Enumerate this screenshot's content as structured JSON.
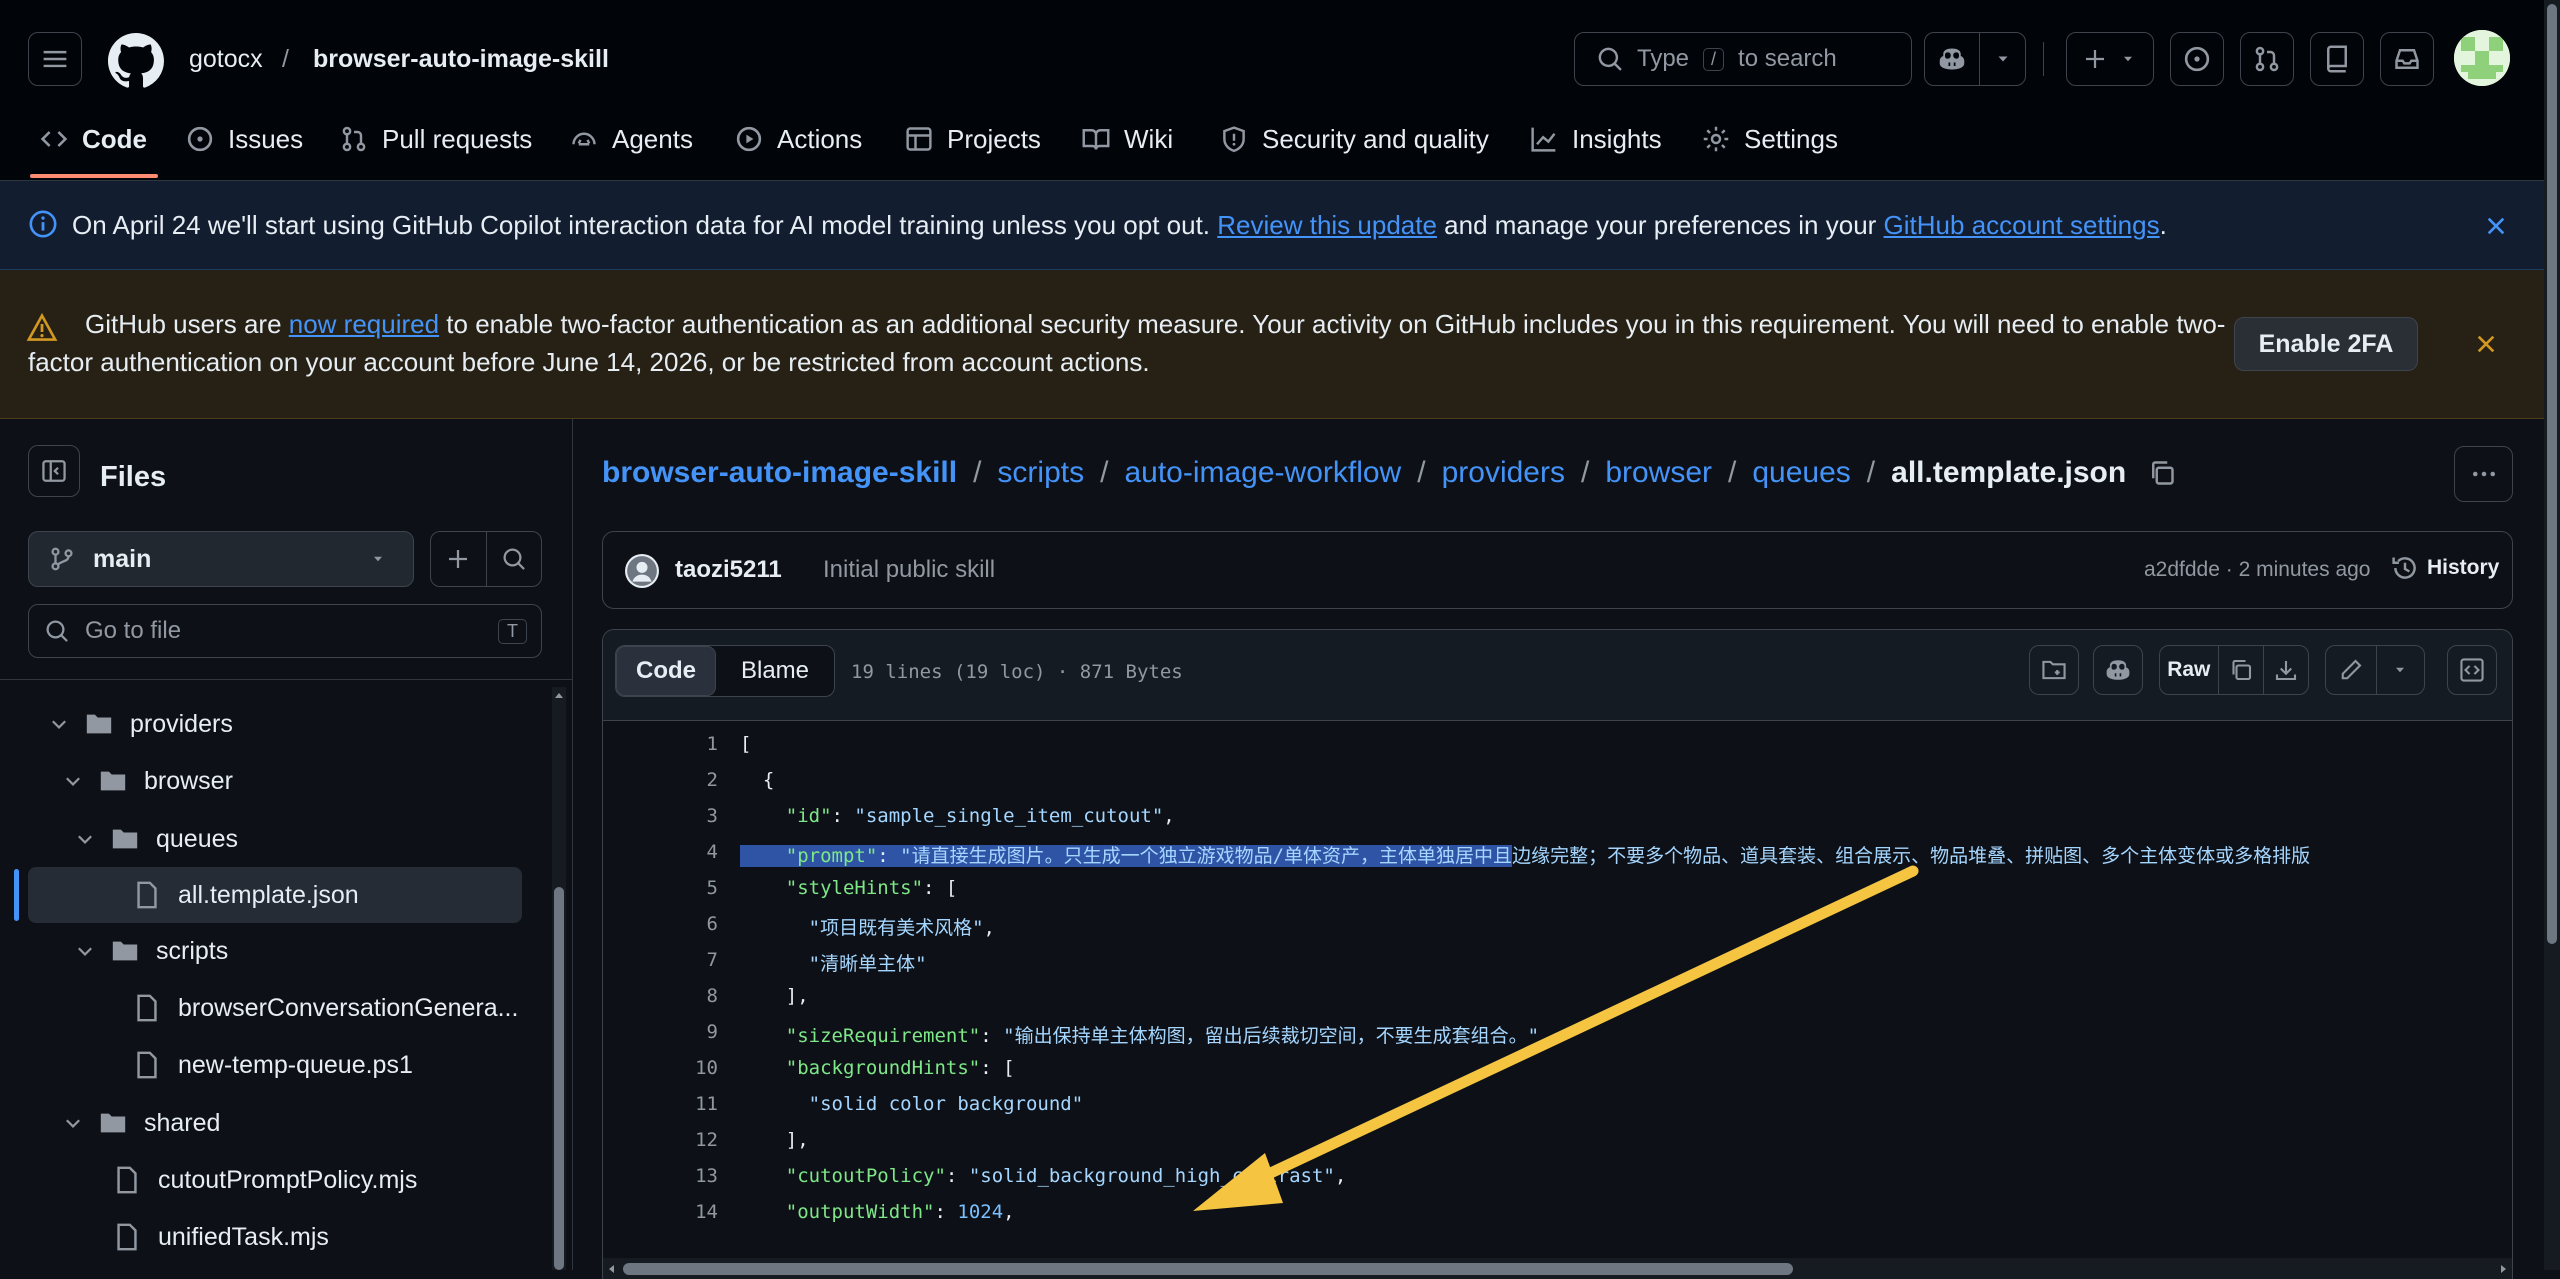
{
  "header": {
    "owner": "gotocx",
    "separator": "/",
    "repo": "browser-auto-image-skill",
    "search": {
      "prefix": "Type",
      "key": "/",
      "suffix": "to search"
    }
  },
  "tabs": [
    {
      "label": "Code",
      "icon": "code-icon",
      "active": true
    },
    {
      "label": "Issues",
      "icon": "issue-icon"
    },
    {
      "label": "Pull requests",
      "icon": "pull-request-icon"
    },
    {
      "label": "Agents",
      "icon": "agents-icon"
    },
    {
      "label": "Actions",
      "icon": "actions-play-icon"
    },
    {
      "label": "Projects",
      "icon": "projects-table-icon"
    },
    {
      "label": "Wiki",
      "icon": "book-icon"
    },
    {
      "label": "Security and quality",
      "icon": "shield-icon"
    },
    {
      "label": "Insights",
      "icon": "graph-icon"
    },
    {
      "label": "Settings",
      "icon": "gear-icon"
    }
  ],
  "banner_copilot": {
    "text1": "On April 24 we'll start using GitHub Copilot interaction data for AI model training unless you opt out. ",
    "link1": "Review this update",
    "text2": " and manage your preferences in your ",
    "link2": "GitHub account settings",
    "text3": "."
  },
  "banner_2fa": {
    "text1": "GitHub users are ",
    "link": "now required",
    "text2": " to enable two-factor authentication as an additional security measure. Your activity on GitHub includes you in this requirement. You will need to enable two-",
    "line2": "factor authentication on your account before June 14, 2026, or be restricted from account actions.",
    "button": "Enable 2FA"
  },
  "sidebar": {
    "title": "Files",
    "branch": "main",
    "goto_placeholder": "Go to file",
    "goto_key": "T",
    "tree": [
      {
        "label": "providers",
        "type": "folder"
      },
      {
        "label": "browser",
        "type": "folder"
      },
      {
        "label": "queues",
        "type": "folder"
      },
      {
        "label": "all.template.json",
        "type": "file",
        "selected": true
      },
      {
        "label": "scripts",
        "type": "folder"
      },
      {
        "label": "browserConversationGenera...",
        "type": "file"
      },
      {
        "label": "new-temp-queue.ps1",
        "type": "file"
      },
      {
        "label": "shared",
        "type": "folder"
      },
      {
        "label": "cutoutPromptPolicy.mjs",
        "type": "file"
      },
      {
        "label": "unifiedTask.mjs",
        "type": "file"
      }
    ]
  },
  "breadcrumb": {
    "parts": [
      "browser-auto-image-skill",
      "scripts",
      "auto-image-workflow",
      "providers",
      "browser",
      "queues"
    ],
    "sep": "/",
    "file": "all.template.json"
  },
  "commit": {
    "author": "taozi5211",
    "message": "Initial public skill",
    "meta": "a2dfdde · 2 minutes ago",
    "history": "History"
  },
  "file_toolbar": {
    "code": "Code",
    "blame": "Blame",
    "info": "19 lines (19 loc) · 871 Bytes",
    "raw": "Raw"
  },
  "code": {
    "line_numbers": [
      "1",
      "2",
      "3",
      "4",
      "5",
      "6",
      "7",
      "8",
      "9",
      "10",
      "11",
      "12",
      "13",
      "14"
    ],
    "l1": "[",
    "l2": "  {",
    "l3k": "\"id\"",
    "l3v": "\"sample_single_item_cutout\"",
    "l4k": "\"prompt\"",
    "l4v_sel": "\"请直接生成图片。只生成一个独立游戏物品/单体资产，主体单独居中且",
    "l4v_rest": "边缘完整；不要多个物品、道具套装、组合展示、物品堆叠、拼贴图、多个主体变体或多格排版",
    "l5k": "\"styleHints\"",
    "l6v": "\"项目既有美术风格\"",
    "l7v": "\"清晰单主体\"",
    "l8": "],",
    "l9k": "\"sizeRequirement\"",
    "l9v": "\"输出保持单主体构图，留出后续裁切空间，不要生成",
    "l9v2": "套组合。\"",
    "l10k": "\"backgroundHints\"",
    "l11v": "\"solid color background\"",
    "l12": "],",
    "l13k": "\"cutoutPolicy\"",
    "l13v": "\"solid_background_high_contrast\"",
    "l14k": "\"outputWidth\"",
    "l14v": "1024"
  },
  "colors": {
    "accent": "#fd8c73",
    "link": "#4493f8",
    "annotation_arrow": "#f5c542"
  }
}
